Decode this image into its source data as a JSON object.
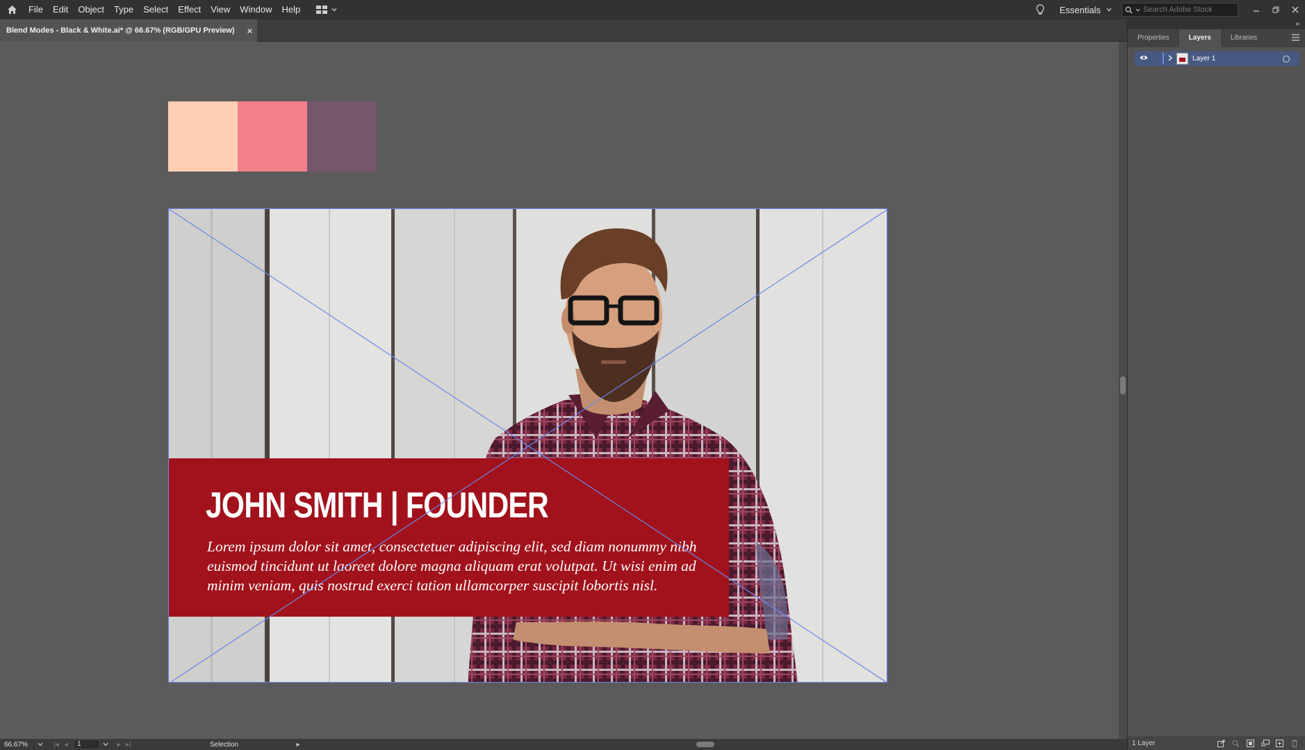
{
  "menubar": {
    "items": [
      "File",
      "Edit",
      "Object",
      "Type",
      "Select",
      "Effect",
      "View",
      "Window",
      "Help"
    ],
    "workspace": "Essentials",
    "stock_search_placeholder": "Search Adobe Stock",
    "icons": [
      "home-icon",
      "workspace-layout-icon",
      "lightbulb-icon",
      "search-icon",
      "minimize-icon",
      "restore-icon",
      "close-icon"
    ]
  },
  "document_tab": {
    "title": "Blend Modes - Black & White.ai* @ 66.67% (RGB/GPU Preview)",
    "close": "×"
  },
  "swatches": [
    "#fecdb3",
    "#f2808b",
    "#76566b"
  ],
  "artboard": {
    "headline": "JOHN SMITH | FOUNDER",
    "body": "Lorem ipsum dolor sit amet, consectetuer adipiscing elit, sed diam nonummy nibh euismod tincidunt ut laoreet dolore magna aliquam erat volutpat. Ut wisi enim ad minim veniam, quis nostrud exerci tation ullamcorper suscipit lobortis nisl.",
    "banner_color": "#a1121c"
  },
  "statusbar": {
    "zoom": "66.67%",
    "page": "1",
    "tool": "Selection"
  },
  "panel": {
    "tabs": [
      "Properties",
      "Layers",
      "Libraries"
    ],
    "active_tab": "Layers",
    "layers": [
      {
        "name": "Layer 1"
      }
    ],
    "footer_count": "1 Layer"
  },
  "colors": {
    "app_bar": "#323232",
    "canvas": "#5b5b5b",
    "selection": "#6d87e6"
  }
}
